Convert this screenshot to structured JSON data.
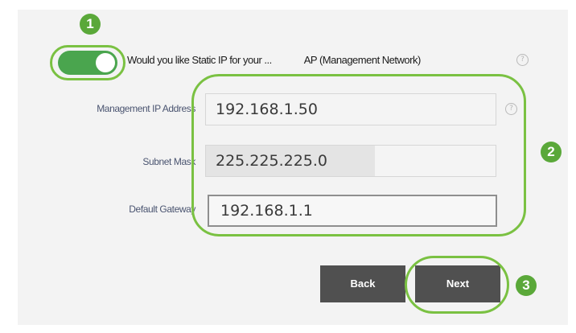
{
  "form": {
    "static_ip_question_start": "Would you like Static IP for your",
    "static_ip_question_ellipsis": "...",
    "static_ip_question_end": "AP (Management Network)",
    "static_ip_enabled": true,
    "help_glyph": "?",
    "management_ip": {
      "label": "Management IP Address",
      "value": "192.168.1.50"
    },
    "subnet_mask": {
      "label": "Subnet Mask",
      "value": "225.225.225.0"
    },
    "default_gateway": {
      "label": "Default Gateway",
      "value": "192.168.1.1"
    }
  },
  "buttons": {
    "back_label": "Back",
    "next_label": "Next"
  },
  "callouts": [
    "1",
    "2",
    "3"
  ],
  "colors": {
    "accent_green": "#5aa839",
    "ring_green": "#7ac142",
    "button_gray": "#505050"
  },
  "icons": {
    "help": "question-circle-icon"
  }
}
